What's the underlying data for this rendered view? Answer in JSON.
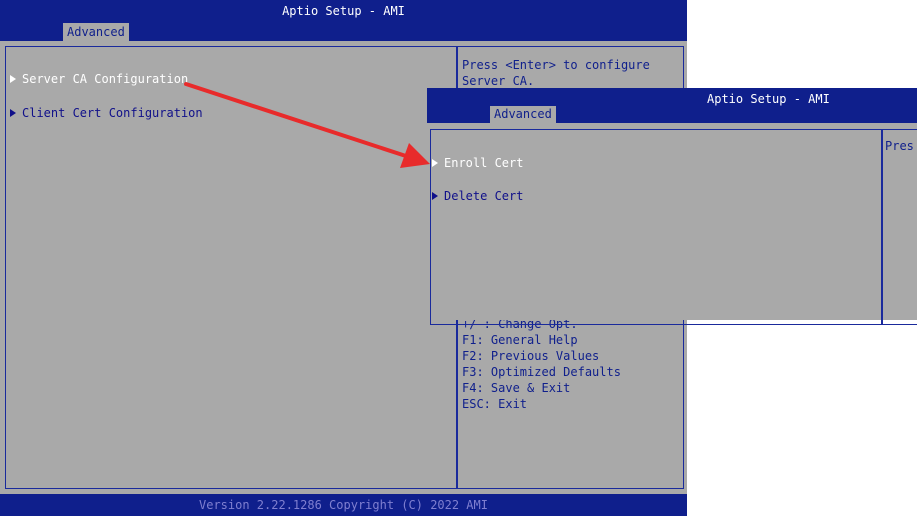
{
  "main": {
    "title": "Aptio Setup - AMI",
    "tab": "Advanced",
    "items": [
      {
        "label": "Server CA Configuration"
      },
      {
        "label": "Client Cert Configuration"
      }
    ],
    "help_text": "Press <Enter> to configure Server CA.",
    "keys": [
      "+/-: Change Opt.",
      "F1: General Help",
      "F2: Previous Values",
      "F3: Optimized Defaults",
      "F4: Save & Exit",
      "ESC: Exit"
    ],
    "footer": "Version 2.22.1286 Copyright (C) 2022 AMI"
  },
  "sub": {
    "title": "Aptio Setup - AMI",
    "tab": "Advanced",
    "items": [
      {
        "label": "Enroll Cert"
      },
      {
        "label": "Delete Cert"
      }
    ],
    "help_partial": "Pres"
  },
  "colors": {
    "bios_blue": "#0f1f8c",
    "bios_gray": "#a9a9a9",
    "arrow_red": "#e82b2b"
  }
}
